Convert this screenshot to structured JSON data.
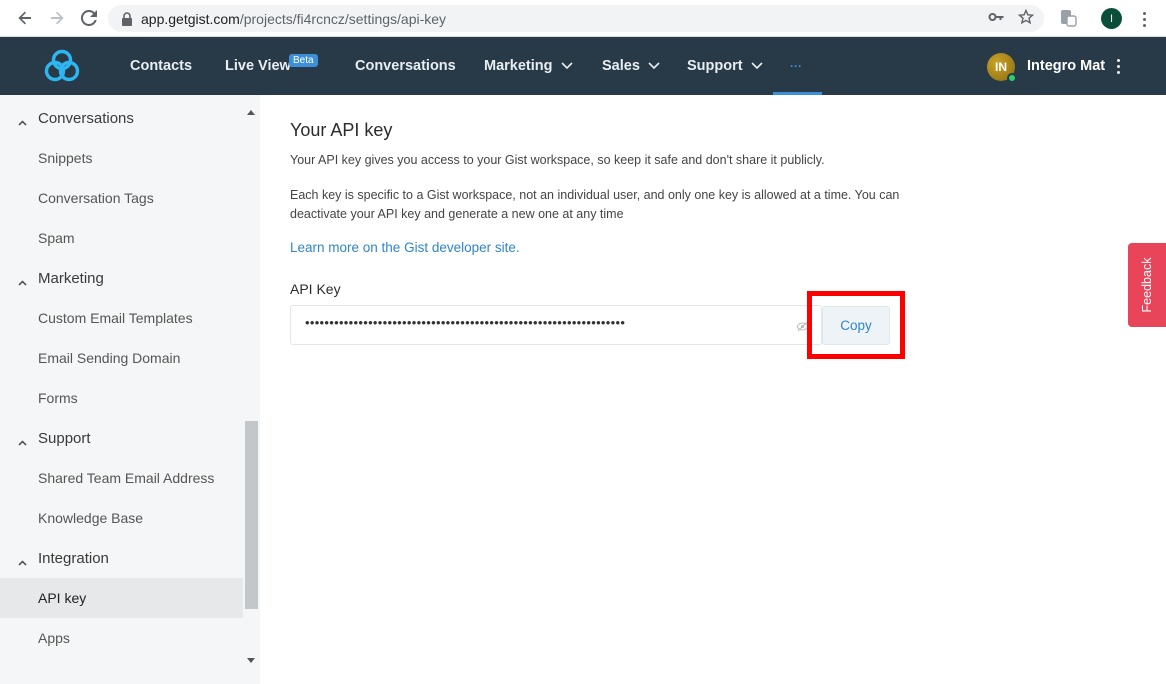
{
  "browser": {
    "url_host": "app.getgist.com",
    "url_path": "/projects/fi4rcncz/settings/api-key",
    "profile_initial": "I"
  },
  "header": {
    "nav": [
      {
        "label": "Contacts"
      },
      {
        "label": "Live View",
        "badge": "Beta"
      },
      {
        "label": "Conversations"
      },
      {
        "label": "Marketing"
      },
      {
        "label": "Sales"
      },
      {
        "label": "Support"
      },
      {
        "label": "···"
      }
    ],
    "user": {
      "initials": "IN",
      "name": "Integro Mat"
    }
  },
  "sidebar": {
    "items": [
      {
        "label": "Conversations",
        "type": "group"
      },
      {
        "label": "Snippets",
        "type": "item"
      },
      {
        "label": "Conversation Tags",
        "type": "item"
      },
      {
        "label": "Spam",
        "type": "item"
      },
      {
        "label": "Marketing",
        "type": "group"
      },
      {
        "label": "Custom Email Templates",
        "type": "item"
      },
      {
        "label": "Email Sending Domain",
        "type": "item"
      },
      {
        "label": "Forms",
        "type": "item"
      },
      {
        "label": "Support",
        "type": "group"
      },
      {
        "label": "Shared Team Email Address",
        "type": "item"
      },
      {
        "label": "Knowledge Base",
        "type": "item"
      },
      {
        "label": "Integration",
        "type": "group"
      },
      {
        "label": "API key",
        "type": "item",
        "active": true
      },
      {
        "label": "Apps",
        "type": "item"
      }
    ]
  },
  "main": {
    "title": "Your API key",
    "para1": "Your API key gives you access to your Gist workspace, so keep it safe and don't share it publicly.",
    "para2": "Each key is specific to a Gist workspace, not an individual user, and only one key is allowed at a time. You can deactivate your API key and generate a new one at any time",
    "learn_link": "Learn more on the Gist developer site.",
    "field_label": "API Key",
    "api_key_masked": "••••••••••••••••••••••••••••••••••••••••••••••••••••••••••••••••••",
    "copy_label": "Copy"
  },
  "feedback": {
    "label": "Feedback"
  },
  "colors": {
    "header_bg": "#283a48",
    "accent": "#3d8fd8",
    "link": "#2f86c8",
    "highlight": "#ff0000",
    "feedback": "#e8445a"
  }
}
